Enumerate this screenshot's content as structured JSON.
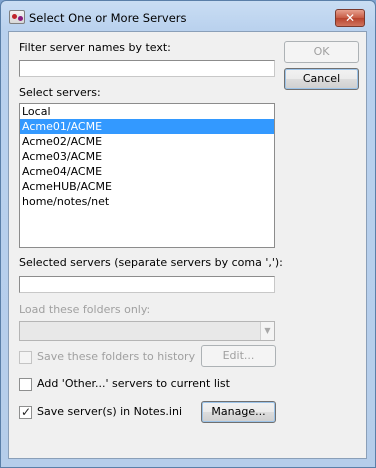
{
  "window": {
    "title": "Select One or More Servers",
    "close_glyph": "✕"
  },
  "filter": {
    "label": "Filter server names by text:",
    "value": ""
  },
  "servers": {
    "label": "Select servers:",
    "items": [
      {
        "name": "Local",
        "selected": false
      },
      {
        "name": "Acme01/ACME",
        "selected": true
      },
      {
        "name": "Acme02/ACME",
        "selected": false
      },
      {
        "name": "Acme03/ACME",
        "selected": false
      },
      {
        "name": "Acme04/ACME",
        "selected": false
      },
      {
        "name": "AcmeHUB/ACME",
        "selected": false
      },
      {
        "name": "home/notes/net",
        "selected": false
      }
    ]
  },
  "selected_servers": {
    "label": "Selected servers (separate servers by coma ','):",
    "value": ""
  },
  "folders": {
    "label": "Load these folders only:",
    "value": "",
    "enabled": false
  },
  "save_folders": {
    "label": "Save these folders to history",
    "checked": false,
    "enabled": false
  },
  "add_other": {
    "label": "Add 'Other...' servers to current list",
    "checked": false
  },
  "save_servers": {
    "label": "Save server(s) in Notes.ini",
    "checked": true
  },
  "buttons": {
    "ok": "OK",
    "cancel": "Cancel",
    "edit": "Edit...",
    "manage": "Manage..."
  },
  "icons": {
    "title": "servers-app-icon",
    "check": "✓",
    "dropdown": "▼"
  }
}
